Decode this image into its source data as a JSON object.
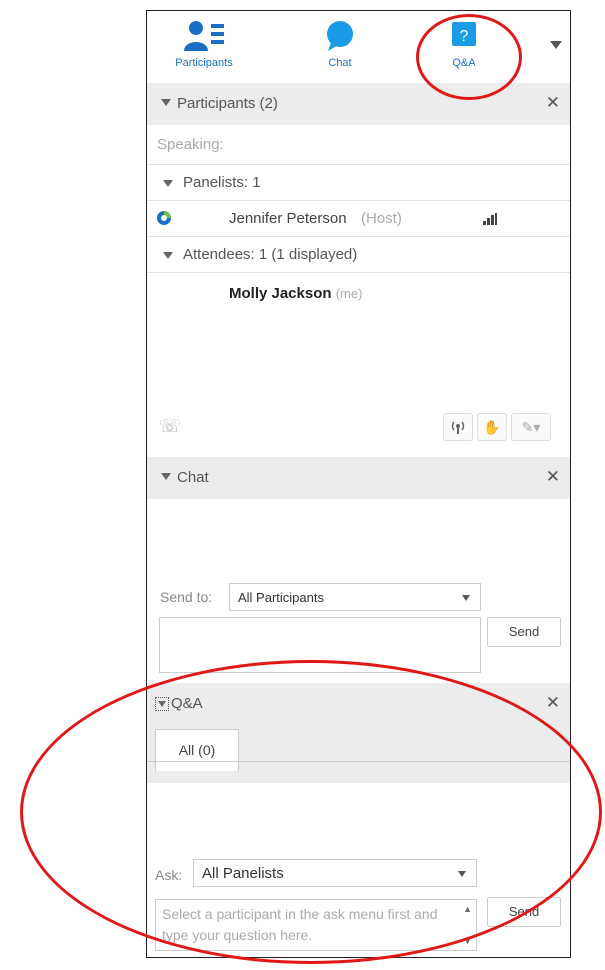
{
  "toolbar": {
    "participants_label": "Participants",
    "chat_label": "Chat",
    "qa_label": "Q&A",
    "qa_icon_glyph": "?"
  },
  "participants": {
    "header": "Participants (2)",
    "speaking_label": "Speaking:",
    "panelists_label": "Panelists: 1",
    "panelist_name": "Jennifer Peterson",
    "panelist_role": "(Host)",
    "attendees_label": "Attendees: 1 (1 displayed)",
    "attendee_name": "Molly Jackson",
    "attendee_tag": "(me)"
  },
  "chat": {
    "header": "Chat",
    "send_to_label": "Send to:",
    "send_to_value": "All Participants",
    "send_label": "Send"
  },
  "qa": {
    "header": "Q&A",
    "tab_all": "All (0)",
    "ask_label": "Ask:",
    "ask_value": "All Panelists",
    "placeholder": "Select a participant in the ask menu first and type your question here.",
    "send_label": "Send"
  },
  "colors": {
    "accent_blue": "#1a6fc4",
    "annotation_red": "#e01818",
    "header_gray": "#ececec"
  }
}
